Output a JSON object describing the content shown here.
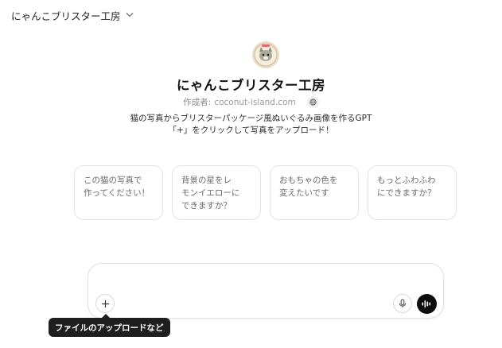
{
  "header": {
    "title": "にゃんこブリスター工房",
    "chevron_icon": "chevron-down-icon"
  },
  "gpt": {
    "avatar_icon": "cat-avatar-icon",
    "name": "にゃんこブリスター工房",
    "creator_label": "作成者:",
    "creator_domain": "coconut-island.com",
    "globe_icon": "globe-icon",
    "description_line1": "猫の写真からブリスターパッケージ風ぬいぐるみ画像を作るGPT",
    "description_line2": "「+」をクリックして写真をアップロード！"
  },
  "prompts": [
    {
      "text": "この猫の写真で\n作ってください！"
    },
    {
      "text": "背景の星をレ\nモンイエローに\nできますか？"
    },
    {
      "text": "おもちゃの色を\n変えたいです"
    },
    {
      "text": "もっとふわふわ\nにできますか？"
    }
  ],
  "composer": {
    "plus_icon": "plus-icon",
    "mic_icon": "microphone-icon",
    "voice_icon": "voice-mode-icon"
  },
  "tooltip": {
    "text": "ファイルのアップロードなど"
  },
  "colors": {
    "tooltip_bg": "#1f1f1f",
    "voice_button": "#0d0d0d",
    "card_border": "#e4e4e4"
  }
}
